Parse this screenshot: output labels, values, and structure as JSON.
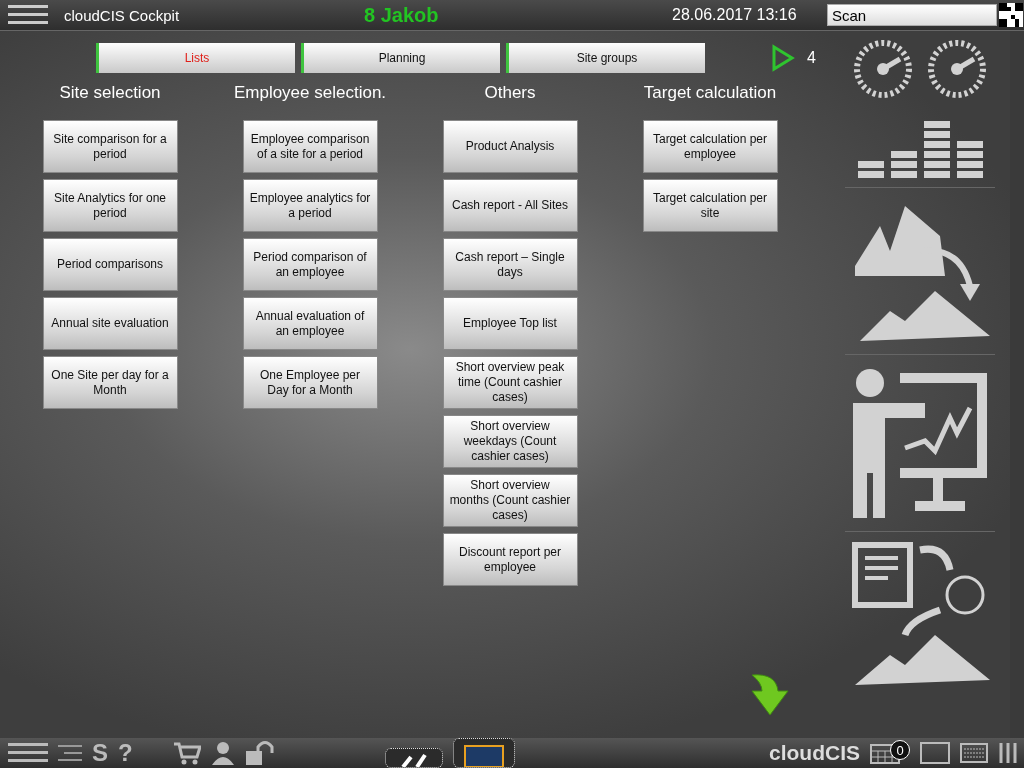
{
  "header": {
    "title": "cloudCIS Cockpit",
    "user": "8 Jakob",
    "datetime": "28.06.2017 13:16",
    "search": {
      "value": "Scan"
    }
  },
  "tabs": [
    {
      "label": "Lists",
      "selected": true
    },
    {
      "label": "Planning",
      "selected": false
    },
    {
      "label": "Site groups",
      "selected": false
    }
  ],
  "play_count": "4",
  "columns": [
    {
      "heading": "Site selection",
      "buttons": [
        "Site comparison for a period",
        "Site Analytics for one period",
        "Period comparisons",
        "Annual site evaluation",
        "One Site per day for a Month"
      ]
    },
    {
      "heading": "Employee selection.",
      "buttons": [
        "Employee comparison of a site for a period",
        "Employee analytics for a period",
        "Period comparison of an employee",
        "Annual evaluation of an employee",
        "One Employee per Day for a Month"
      ]
    },
    {
      "heading": "Others",
      "buttons": [
        "Product Analysis",
        "Cash report - All Sites",
        "Cash report – Single days",
        "Employee Top list",
        "Short overview peak time (Count cashier cases)",
        "Short overview weekdays (Count cashier cases)",
        "Short overview months (Count cashier cases)",
        "Discount report per employee"
      ]
    },
    {
      "heading": "Target calculation",
      "buttons": [
        "Target calculation per employee",
        "Target calculation per site"
      ]
    }
  ],
  "footer": {
    "keys": [
      "S",
      "?"
    ],
    "brand": "cloudCIS",
    "badge": "0"
  }
}
